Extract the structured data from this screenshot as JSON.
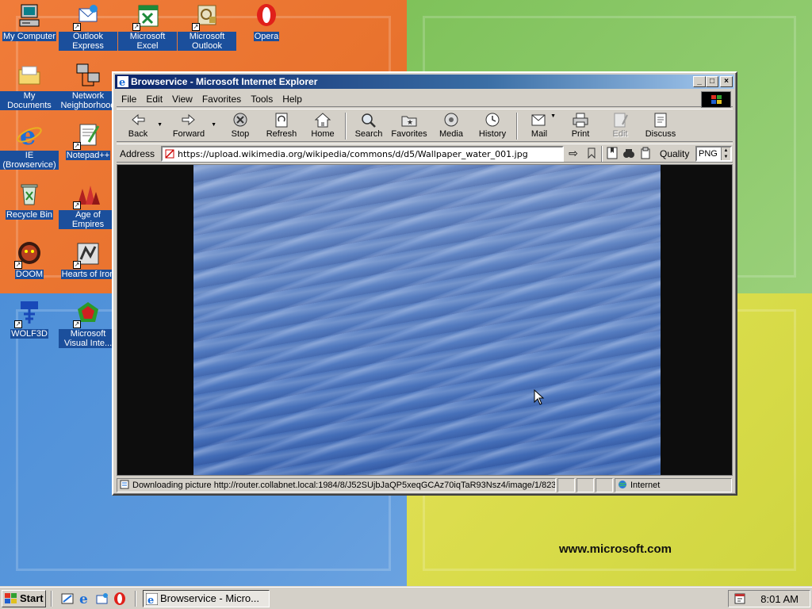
{
  "desktop": {
    "icons": [
      {
        "label": "My Computer"
      },
      {
        "label": "Outlook Express"
      },
      {
        "label": "Microsoft Excel"
      },
      {
        "label": "Microsoft Outlook"
      },
      {
        "label": "Opera"
      },
      {
        "label": "My Documents"
      },
      {
        "label": "Network Neighborhood"
      },
      {
        "label": "IE (Browservice)"
      },
      {
        "label": "Notepad++"
      },
      {
        "label": "Recycle Bin"
      },
      {
        "label": "Age of Empires"
      },
      {
        "label": "DOOM"
      },
      {
        "label": "Hearts of Iron"
      },
      {
        "label": "WOLF3D"
      },
      {
        "label": "Microsoft Visual Inte..."
      }
    ],
    "wallpaper_url": "www.microsoft.com",
    "colors": {
      "orange": "#f07c3a",
      "green": "#8cc96a",
      "blue": "#5a98dc",
      "yellow": "#dcdc4a"
    }
  },
  "window": {
    "title": "Browservice - Microsoft Internet Explorer",
    "menu": [
      "File",
      "Edit",
      "View",
      "Favorites",
      "Tools",
      "Help"
    ],
    "toolbar": {
      "back": "Back",
      "forward": "Forward",
      "stop": "Stop",
      "refresh": "Refresh",
      "home": "Home",
      "search": "Search",
      "favorites": "Favorites",
      "media": "Media",
      "history": "History",
      "mail": "Mail",
      "print": "Print",
      "edit": "Edit",
      "discuss": "Discuss"
    },
    "address": {
      "label": "Address",
      "url": "https://upload.wikimedia.org/wikipedia/commons/d/d5/Wallpaper_water_001.jpg",
      "quality_label": "Quality",
      "quality_value": "PNG"
    },
    "status": {
      "text": "Downloading picture http://router.collabnet.local:1984/8/J52SUjbJaQP5xeqGCAz70iqTaR93Nsz4/image/1/823/",
      "zone": "Internet"
    }
  },
  "taskbar": {
    "start": "Start",
    "task": "Browservice - Micro...",
    "clock": "8:01 AM"
  }
}
